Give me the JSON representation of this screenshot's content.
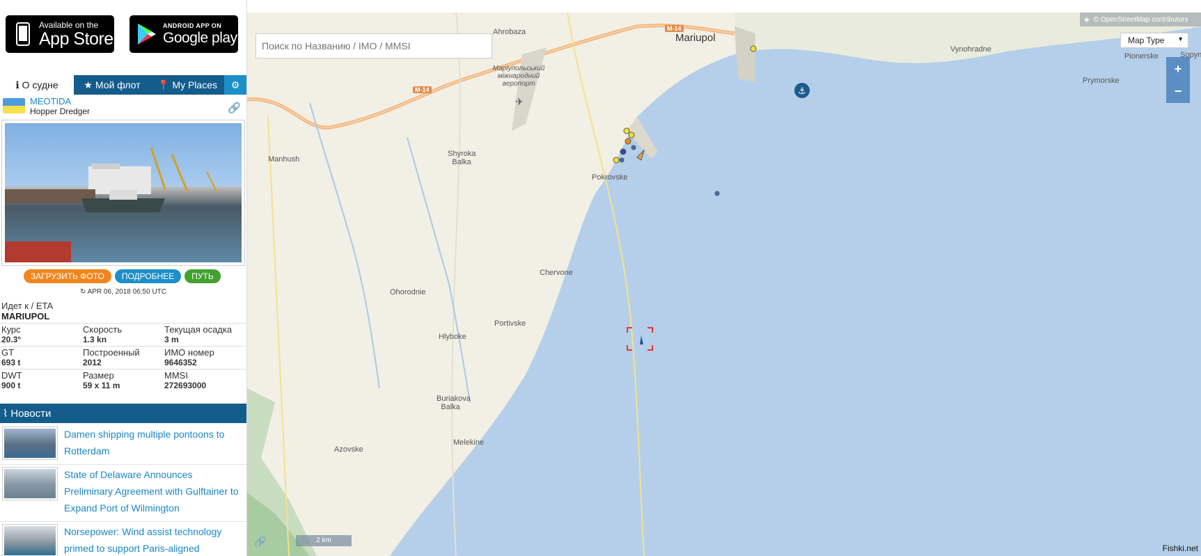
{
  "stores": {
    "apple_small": "Available on the",
    "apple_big": "App Store",
    "google_small": "ANDROID APP ON",
    "google_big": "Google play"
  },
  "tabs": [
    {
      "label": "О судне",
      "icon": "info-icon"
    },
    {
      "label": "Мой флот",
      "icon": "star-icon"
    },
    {
      "label": "My Places",
      "icon": "pin-icon"
    },
    {
      "label": "",
      "icon": "gear-icon"
    }
  ],
  "vessel": {
    "name": "MEOTIDA",
    "type": "Hopper Dredger",
    "flag_colors": [
      "#4c9be0",
      "#f7e04a"
    ],
    "buttons": {
      "upload": "ЗАГРУЗИТЬ ФОТО",
      "details": "ПОДРОБНЕЕ",
      "route": "ПУТЬ"
    },
    "timestamp": "APR 06, 2018 06:50 UTC",
    "eta_label": "Идет к / ETA",
    "eta_value": "MARIUPOL",
    "fields": [
      [
        {
          "label": "Курс",
          "value": "20.3°"
        },
        {
          "label": "Скорость",
          "value": "1.3 kn"
        },
        {
          "label": "Текущая осадка",
          "value": "3 m"
        }
      ],
      [
        {
          "label": "GT",
          "value": "693 t"
        },
        {
          "label": "Построенный",
          "value": "2012"
        },
        {
          "label": "ИМО номер",
          "value": "9646352"
        }
      ],
      [
        {
          "label": "DWT",
          "value": "900 t"
        },
        {
          "label": "Размер",
          "value": "59 x 11 m"
        },
        {
          "label": "MMSI",
          "value": "272693000"
        }
      ]
    ]
  },
  "news": {
    "title": "Новости",
    "items": [
      {
        "text": "Damen shipping multiple pontoons to Rotterdam"
      },
      {
        "text": "State of Delaware Announces Preliminary Agreement with Gulftainer to Expand Port of Wilmington"
      },
      {
        "text": "Norsepower: Wind assist technology primed to support Paris-aligned"
      }
    ]
  },
  "map": {
    "search_placeholder": "Поиск по Названию / IMO / MMSI",
    "attribution": "© OpenStreetMap contributors",
    "map_type": "Map Type",
    "zoom_in": "+",
    "zoom_out": "−",
    "scale": "2 km",
    "watermark": "Fishki.net",
    "labels": {
      "mariupol": "Mariupol",
      "ahrobaza": "Ahrobaza",
      "airport": "Маріупольський міжнародний аеропорт",
      "manhush": "Manhush",
      "shyroka_balka": "Shyroka Balka",
      "pokrovske": "Pokrovske",
      "chervone": "Chervone",
      "ohorodnie": "Ohorodnie",
      "portivske": "Portivske",
      "hlyboke": "Hlyboke",
      "buriakova_balka": "Buriakova Balka",
      "melekine": "Melekine",
      "azovske": "Azovske",
      "vynohradne": "Vynohradne",
      "pionerske": "Pionerske",
      "sopyne": "Sopyne",
      "prymorske": "Prymorske",
      "road_m14": "M-14"
    }
  }
}
